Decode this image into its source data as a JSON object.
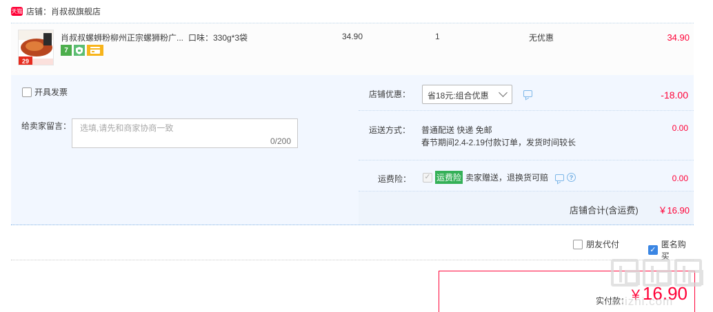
{
  "shop": {
    "badge": "天猫",
    "label": "店铺：肖叔叔旗舰店"
  },
  "item": {
    "title": "肖叔叔螺蛳粉柳州正宗螺狮粉广...",
    "sku": "口味：330g*3袋",
    "price": "34.90",
    "qty": "1",
    "discount": "无优惠",
    "total": "34.90",
    "thumb_badge": "29",
    "service_icons": [
      "seven-day-return-icon",
      "guarantee-icon",
      "credit-card-icon"
    ],
    "seven_label": "7"
  },
  "options": {
    "invoice_label": "开具发票",
    "invoice_checked": false,
    "message_label": "给卖家留言：",
    "message_placeholder": "选填,请先和商家协商一致",
    "message_count": "0/200"
  },
  "pricing": {
    "coupon_label": "店铺优惠：",
    "coupon_selected": "省18元:组合优惠",
    "coupon_amount": "-18.00",
    "shipping_label": "运送方式：",
    "shipping_method": "普通配送 快递 免邮",
    "shipping_note": "春节期间2.4-2.19付款订单，发货时间较长",
    "shipping_amount": "0.00",
    "insurance_label": "运费险：",
    "insurance_badge": "运费险",
    "insurance_text": "卖家赠送，退换货可赔",
    "insurance_amount": "0.00",
    "subtotal_label": "店铺合计(含运费)",
    "subtotal_amount": "￥16.90"
  },
  "extras": {
    "friend_pay_label": "朋友代付",
    "friend_pay_checked": false,
    "anonymous_label": "匿名购买",
    "anonymous_checked": true
  },
  "payment": {
    "label": "实付款：",
    "currency": "￥",
    "amount": "16.90"
  },
  "watermark": {
    "text": "zhizhi.com"
  },
  "colors": {
    "accent_red": "#ff0036",
    "panel_blue": "#f2f7ff",
    "checkbox_blue": "#3b86e3",
    "insurance_green": "#34b057"
  }
}
